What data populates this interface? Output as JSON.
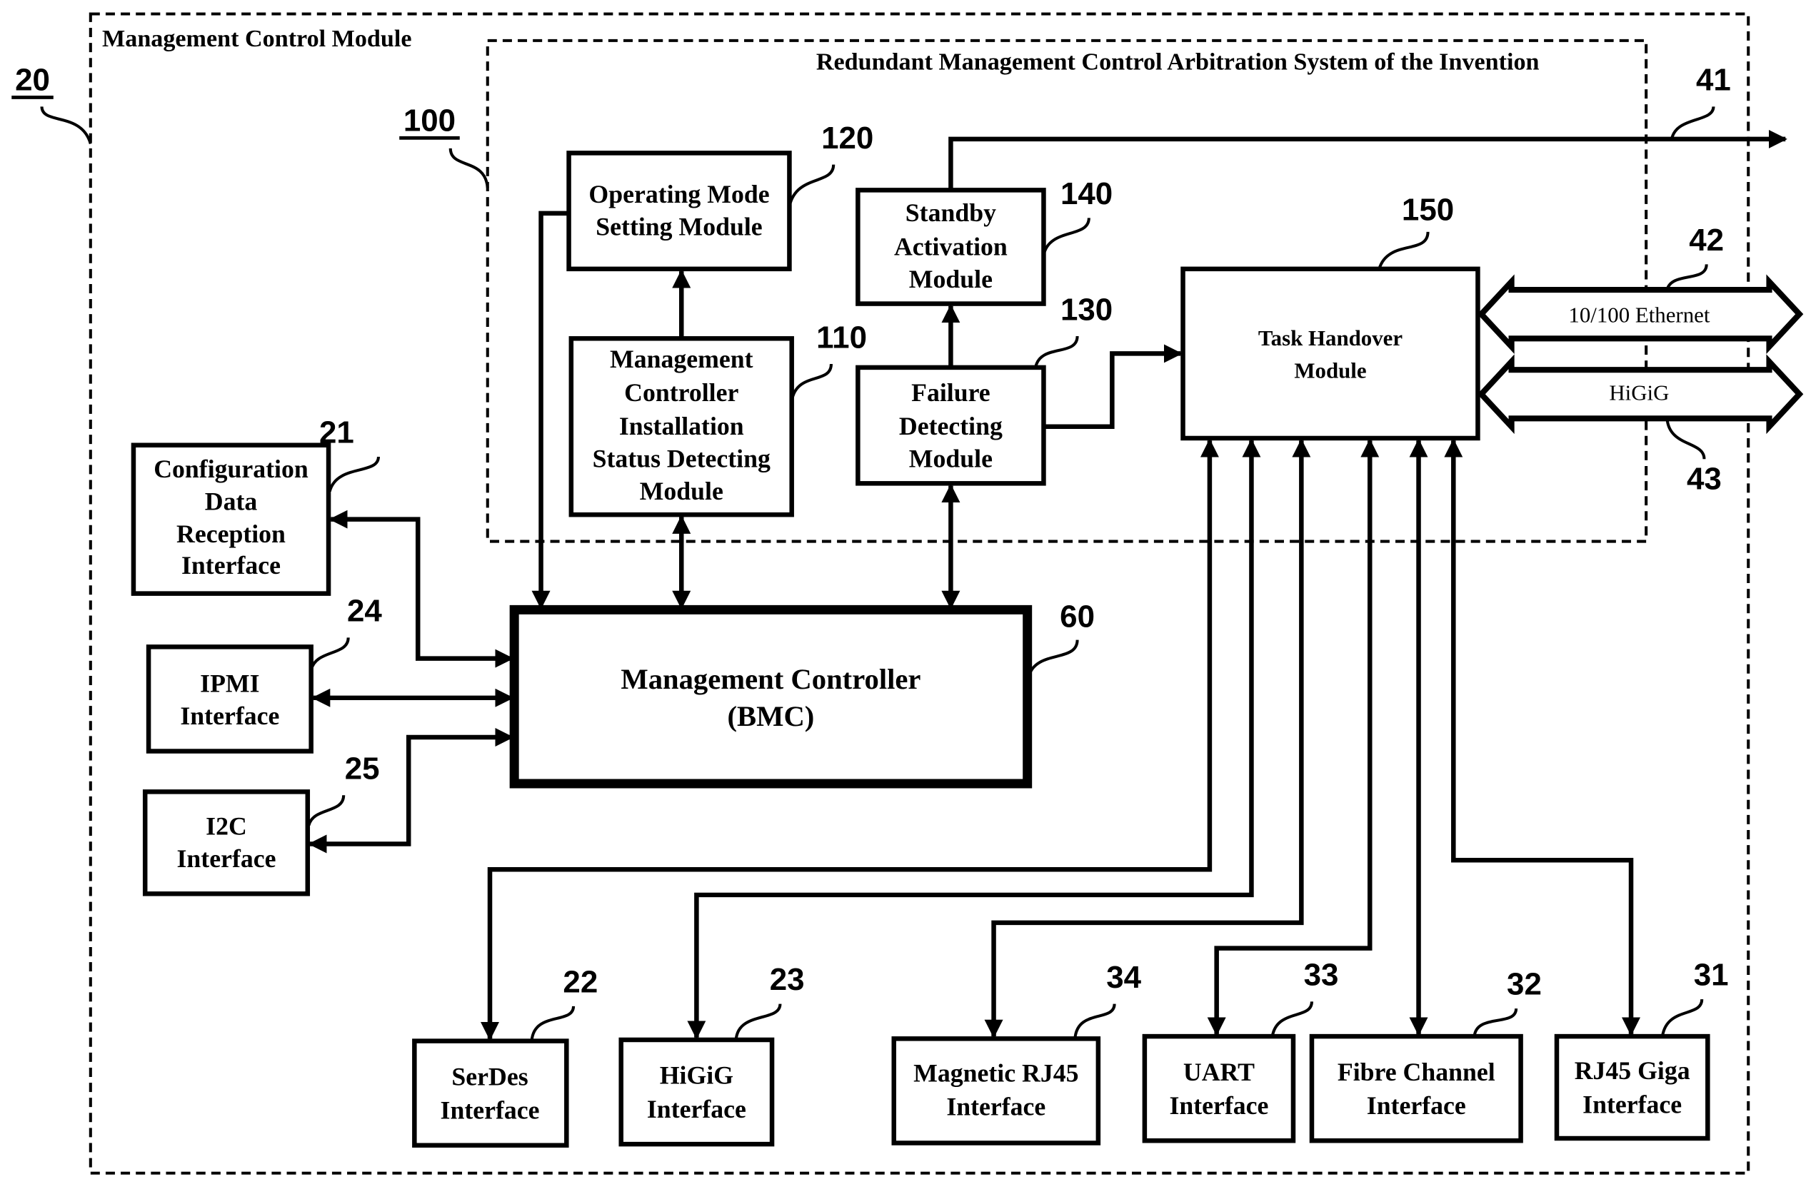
{
  "outer": {
    "title": "Management Control Module",
    "ref": "20"
  },
  "system": {
    "title": "Redundant Management Control Arbitration System of the Invention",
    "ref": "100"
  },
  "modules": {
    "operating_mode": {
      "lines": [
        "Operating Mode",
        "Setting Module"
      ],
      "ref": "120"
    },
    "installation_status": {
      "lines": [
        "Management",
        "Controller",
        "Installation",
        "Status Detecting",
        "Module"
      ],
      "ref": "110"
    },
    "standby_activation": {
      "lines": [
        "Standby",
        "Activation",
        "Module"
      ],
      "ref": "140"
    },
    "failure_detecting": {
      "lines": [
        "Failure",
        "Detecting",
        "Module"
      ],
      "ref": "130"
    },
    "task_handover": {
      "lines": [
        "Task Handover",
        "Module"
      ],
      "ref": "150"
    },
    "bmc": {
      "lines": [
        "Management Controller",
        "(BMC)"
      ],
      "ref": "60"
    }
  },
  "left_interfaces": {
    "config": {
      "lines": [
        "Configuration",
        "Data",
        "Reception",
        "Interface"
      ],
      "ref": "21"
    },
    "ipmi": {
      "lines": [
        "IPMI",
        "Interface"
      ],
      "ref": "24"
    },
    "i2c": {
      "lines": [
        "I2C",
        "Interface"
      ],
      "ref": "25"
    }
  },
  "bottom_interfaces": {
    "serdes": {
      "lines": [
        "SerDes",
        "Interface"
      ],
      "ref": "22"
    },
    "higig": {
      "lines": [
        "HiGiG",
        "Interface"
      ],
      "ref": "23"
    },
    "magnetic_rj45": {
      "lines": [
        "Magnetic RJ45",
        "Interface"
      ],
      "ref": "34"
    },
    "uart": {
      "lines": [
        "UART",
        "Interface"
      ],
      "ref": "33"
    },
    "fibre": {
      "lines": [
        "Fibre Channel",
        "Interface"
      ],
      "ref": "32"
    },
    "rj45_giga": {
      "lines": [
        "RJ45 Giga",
        "Interface"
      ],
      "ref": "31"
    }
  },
  "buses": {
    "output_line": {
      "ref": "41"
    },
    "ethernet": {
      "label": "10/100 Ethernet",
      "ref": "42"
    },
    "higig": {
      "label": "HiGiG",
      "ref": "43"
    }
  }
}
